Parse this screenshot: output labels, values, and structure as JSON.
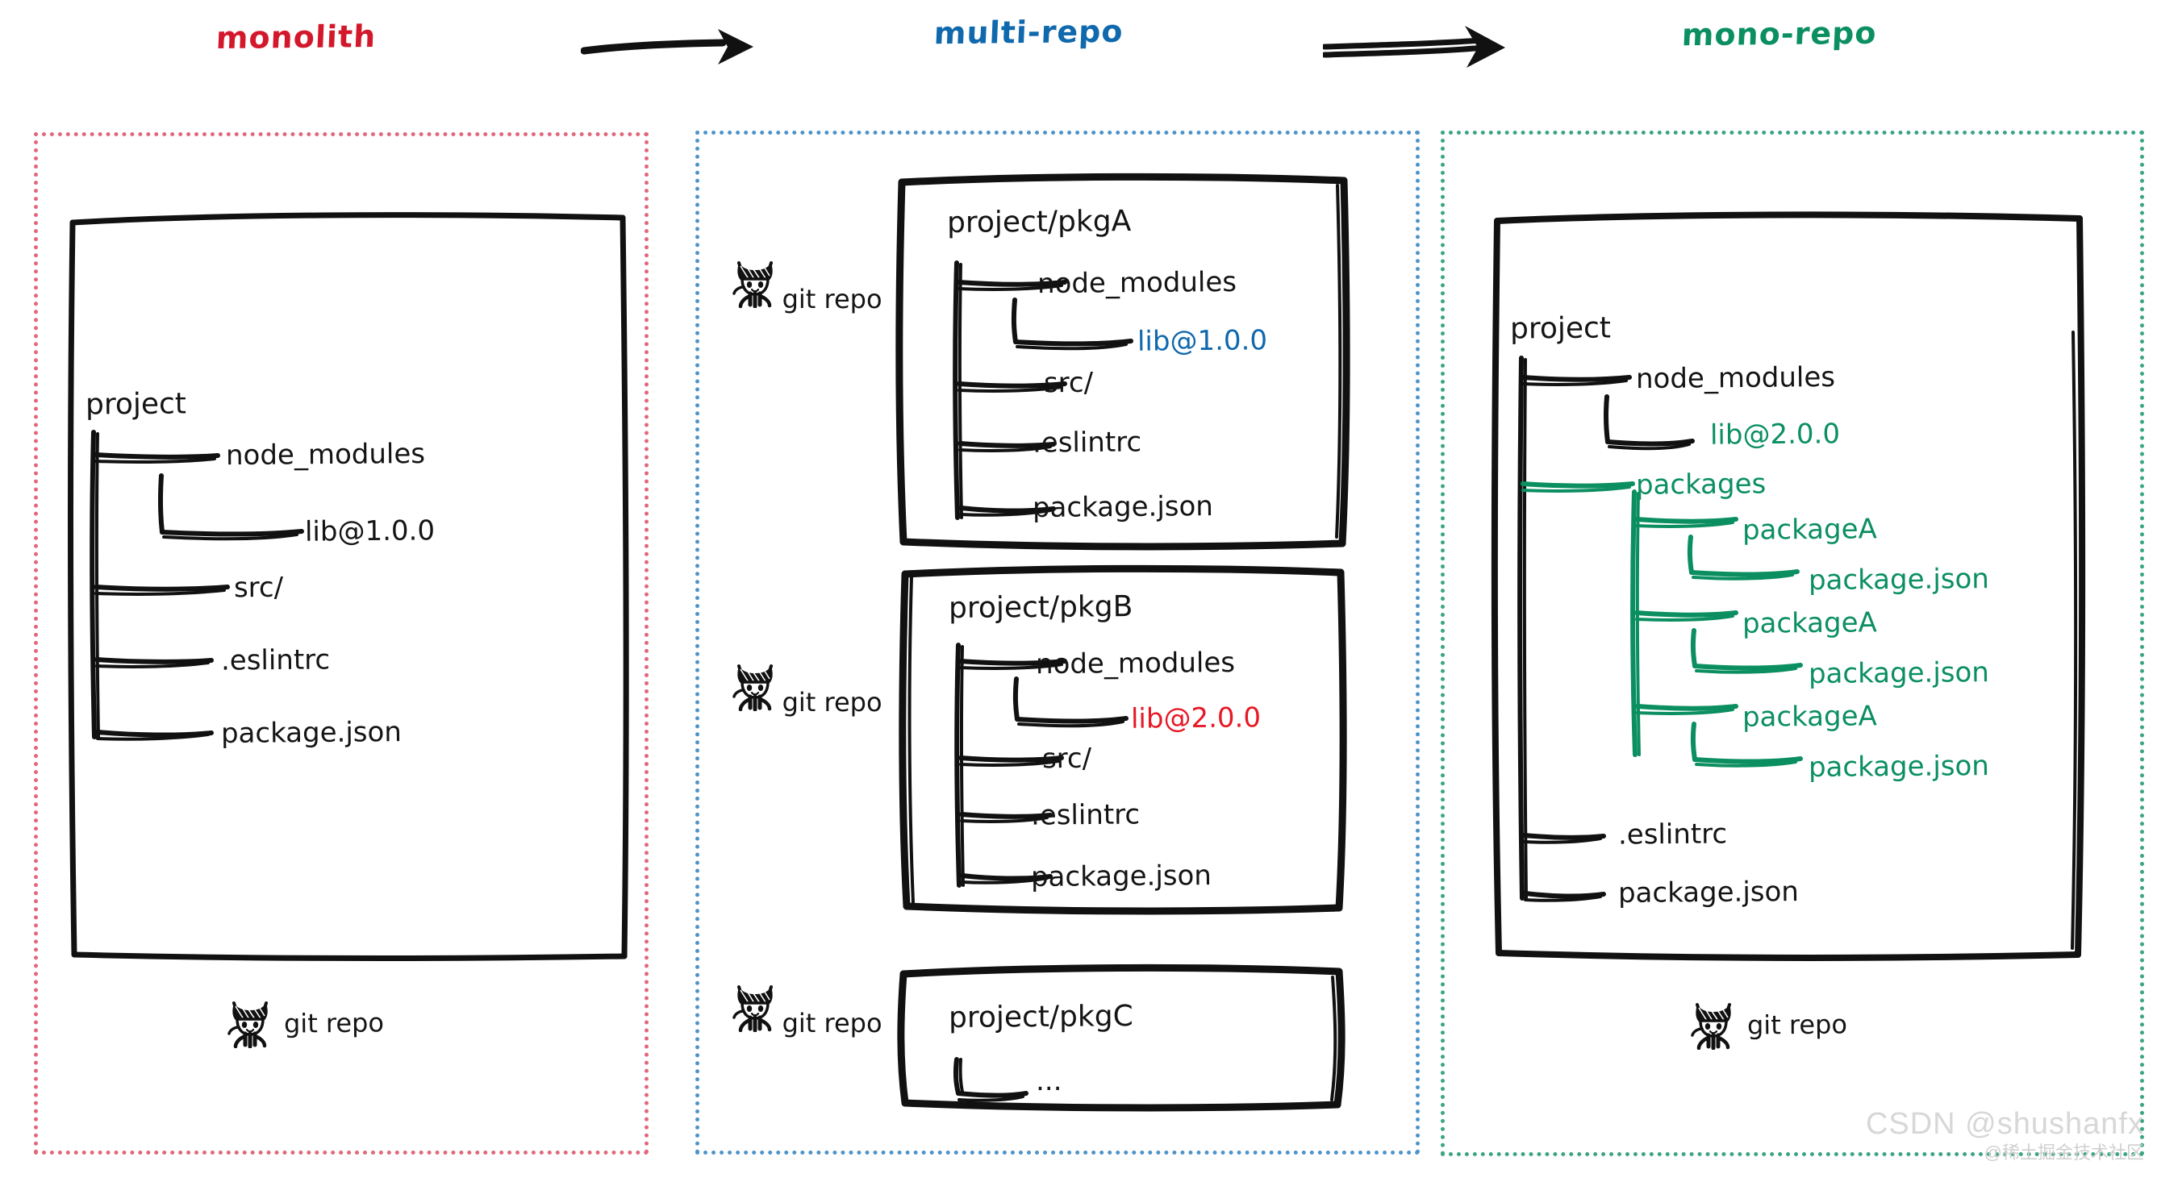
{
  "headers": {
    "monolith": "monolith",
    "multirepo": "multi-repo",
    "monorepo": "mono-repo"
  },
  "colors": {
    "monolith_red": "#d3182b",
    "multirepo_blue": "#1068ad",
    "monorepo_green": "#0b8f61",
    "lib_red": "#e61926",
    "ink": "#141414",
    "panel_red": "#e0687c",
    "panel_blue": "#4c94cc",
    "panel_green": "#3ba586"
  },
  "arrows": {
    "first": "arrow-right-icon",
    "second": "double-arrow-right-icon"
  },
  "monolith": {
    "box": {
      "title": "project",
      "tree": [
        {
          "label": "node_modules",
          "depth": 1
        },
        {
          "label": "lib@1.0.0",
          "depth": 2
        },
        {
          "label": "src/",
          "depth": 1
        },
        {
          "label": ".eslintrc",
          "depth": 1
        },
        {
          "label": "package.json",
          "depth": 1
        }
      ]
    },
    "repo_label": "git repo",
    "repo_icon": "octocat-icon"
  },
  "multirepo": {
    "repos": [
      {
        "icon": "octocat-icon",
        "label": "git repo"
      },
      {
        "icon": "octocat-icon",
        "label": "git repo"
      },
      {
        "icon": "octocat-icon",
        "label": "git repo"
      }
    ],
    "boxes": [
      {
        "title": "project/pkgA",
        "tree": [
          {
            "label": "node_modules",
            "depth": 1,
            "color": "ink"
          },
          {
            "label": "lib@1.0.0",
            "depth": 2,
            "color": "blue"
          },
          {
            "label": "src/",
            "depth": 1,
            "color": "ink"
          },
          {
            "label": ".eslintrc",
            "depth": 1,
            "color": "ink"
          },
          {
            "label": "package.json",
            "depth": 1,
            "color": "ink"
          }
        ]
      },
      {
        "title": "project/pkgB",
        "tree": [
          {
            "label": "node_modules",
            "depth": 1,
            "color": "ink"
          },
          {
            "label": "lib@2.0.0",
            "depth": 2,
            "color": "red"
          },
          {
            "label": "src/",
            "depth": 1,
            "color": "ink"
          },
          {
            "label": ".eslintrc",
            "depth": 1,
            "color": "ink"
          },
          {
            "label": "package.json",
            "depth": 1,
            "color": "ink"
          }
        ]
      },
      {
        "title": "project/pkgC",
        "tree": [
          {
            "label": "...",
            "depth": 1,
            "color": "ink"
          }
        ]
      }
    ]
  },
  "monorepo": {
    "box": {
      "title": "project",
      "tree": [
        {
          "label": "node_modules",
          "depth": 1,
          "color": "ink"
        },
        {
          "label": "lib@2.0.0",
          "depth": 2,
          "color": "green"
        },
        {
          "label": "packages",
          "depth": 1,
          "color": "green"
        },
        {
          "label": "packageA",
          "depth": 2,
          "color": "green"
        },
        {
          "label": "package.json",
          "depth": 3,
          "color": "green"
        },
        {
          "label": "packageA",
          "depth": 2,
          "color": "green"
        },
        {
          "label": "package.json",
          "depth": 3,
          "color": "green"
        },
        {
          "label": "packageA",
          "depth": 2,
          "color": "green"
        },
        {
          "label": "package.json",
          "depth": 3,
          "color": "green"
        },
        {
          "label": ".eslintrc",
          "depth": 1,
          "color": "ink"
        },
        {
          "label": "package.json",
          "depth": 1,
          "color": "ink"
        }
      ]
    },
    "repo_label": "git repo",
    "repo_icon": "octocat-icon"
  },
  "watermark": {
    "main": "CSDN @shushanfx",
    "sub": "@稀土掘金技术社区"
  }
}
